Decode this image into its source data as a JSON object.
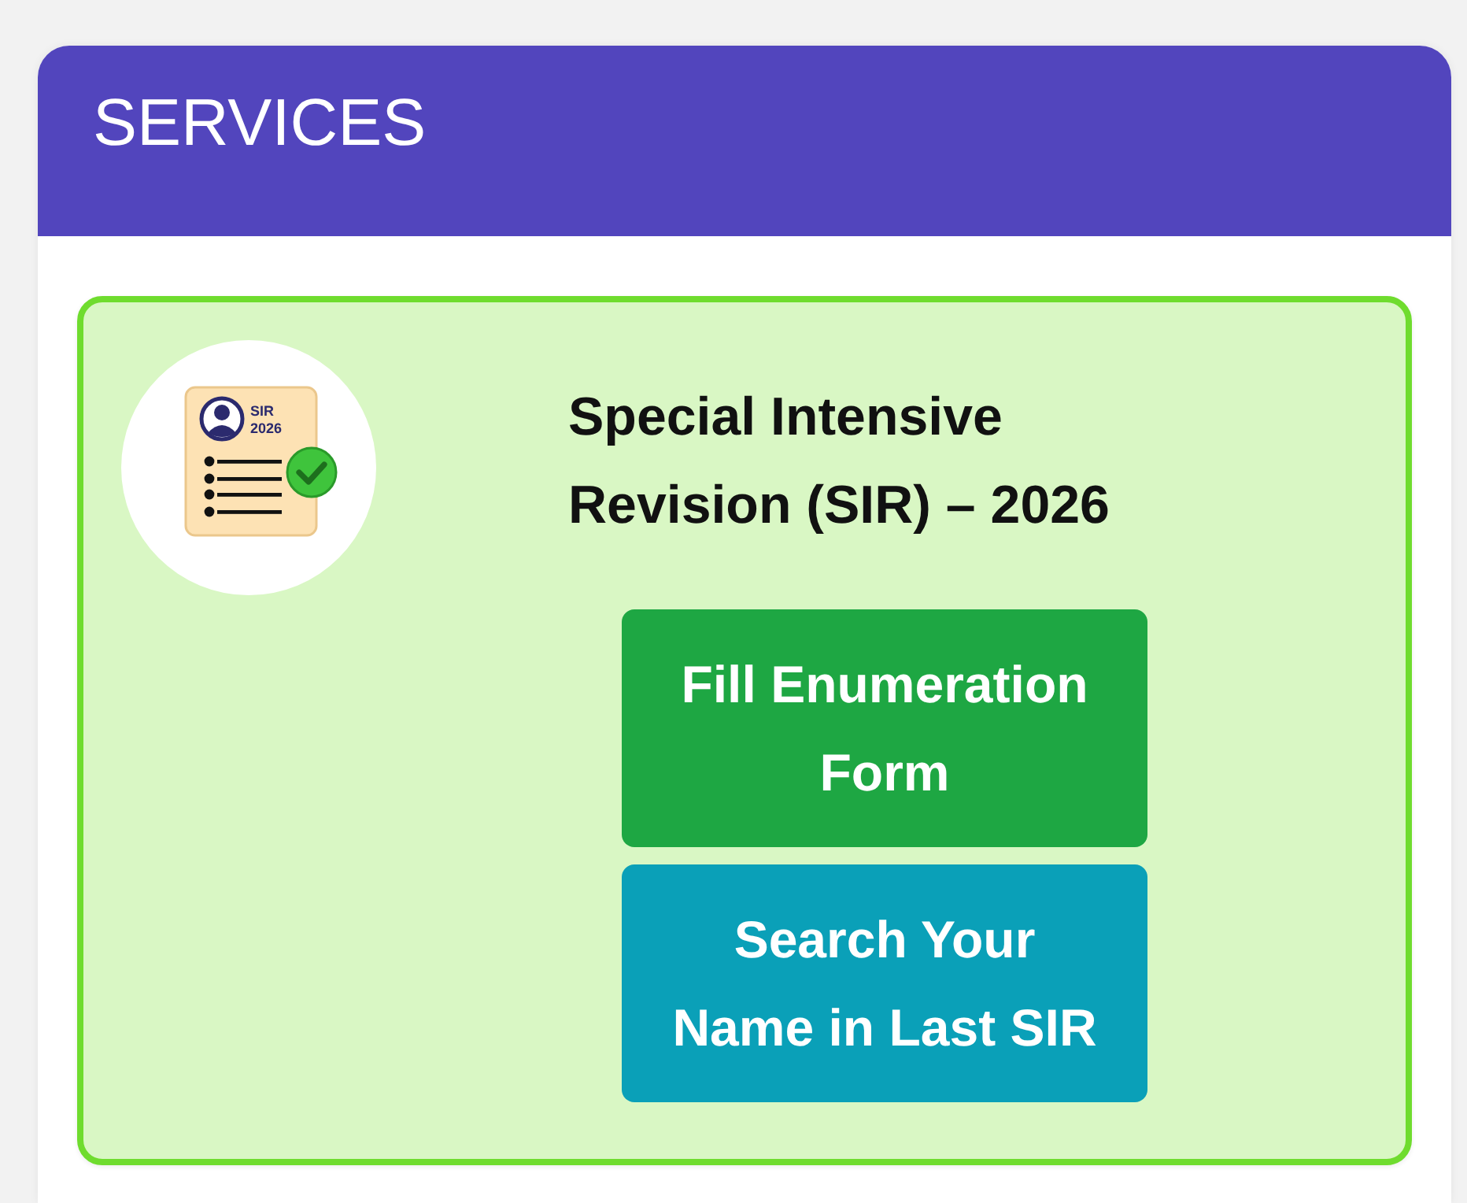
{
  "header": {
    "title": "SERVICES"
  },
  "service_card": {
    "icon_labels": [
      "SIR",
      "2026"
    ],
    "title": "Special Intensive Revision (SIR) – 2026",
    "buttons": [
      {
        "label": "Fill Enumeration Form",
        "kind": "primary"
      },
      {
        "label": "Search Your Name in Last SIR",
        "kind": "secondary"
      }
    ]
  }
}
